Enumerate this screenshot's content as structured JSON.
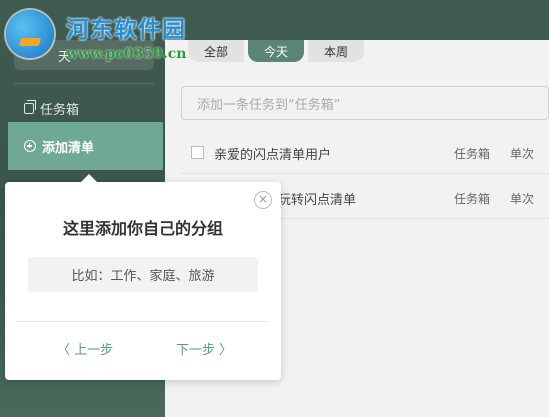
{
  "watermark": {
    "title": "河东软件园",
    "url": "www.pc0359.cn"
  },
  "sidebar": {
    "top_label": "天",
    "items": [
      {
        "label": "任务箱",
        "icon": "inbox-icon"
      },
      {
        "label": "添加清单",
        "icon": "plus-circle-icon"
      }
    ]
  },
  "tabs": [
    {
      "label": "全部"
    },
    {
      "label": "今天",
      "active": true
    },
    {
      "label": "本周"
    }
  ],
  "add_task": {
    "placeholder": "添加一条任务到“任务箱”"
  },
  "tasks": [
    {
      "title": "亲爱的闪点清单用户",
      "list": "任务箱",
      "repeat": "单次"
    },
    {
      "title": "玩转闪点清单",
      "list": "任务箱",
      "repeat": "单次"
    }
  ],
  "popup": {
    "title": "这里添加你自己的分组",
    "example": "比如：工作、家庭、旅游",
    "prev_label": "〈 上一步",
    "next_label": "下一步 〉",
    "close_symbol": "×"
  },
  "colors": {
    "sidebar_bg": "#3f5a4f",
    "accent": "#70a896",
    "link": "#5a9b86"
  }
}
